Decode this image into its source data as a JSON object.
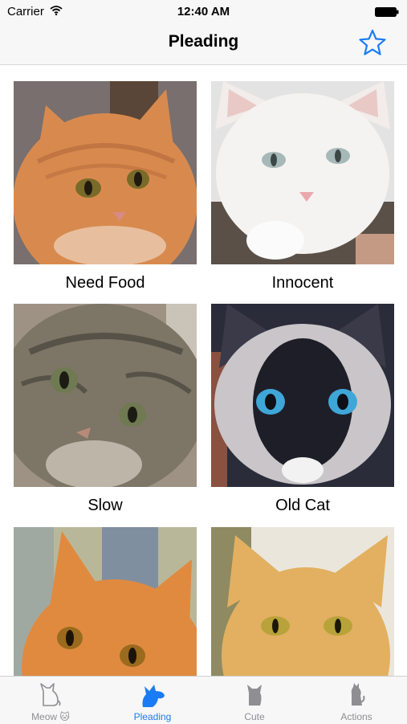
{
  "status_bar": {
    "carrier": "Carrier",
    "time": "12:40 AM"
  },
  "nav": {
    "title": "Pleading",
    "right_icon": "star-icon",
    "accent": "#1a7cf5"
  },
  "cats": [
    {
      "label": "Need Food",
      "fur": "#d88a4e",
      "bg": "#8a7f78"
    },
    {
      "label": "Innocent",
      "fur": "#f4f2f0",
      "bg": "#e3e3e3"
    },
    {
      "label": "Slow",
      "fur": "#7d7566",
      "bg": "#9e9284"
    },
    {
      "label": "Old Cat",
      "fur": "#3a3a48",
      "bg": "#ded8d4"
    },
    {
      "label": "",
      "fur": "#e08a40",
      "bg": "#b9b79a"
    },
    {
      "label": "",
      "fur": "#e2b060",
      "bg": "#ebe6dc"
    }
  ],
  "tabs": [
    {
      "label": "Meow 🐱",
      "icon": "cat-outline-icon",
      "active": false
    },
    {
      "label": "Pleading",
      "icon": "dog-icon",
      "active": true
    },
    {
      "label": "Cute",
      "icon": "cat-sitting-icon",
      "active": false
    },
    {
      "label": "Actions",
      "icon": "cat-standing-icon",
      "active": false
    }
  ]
}
